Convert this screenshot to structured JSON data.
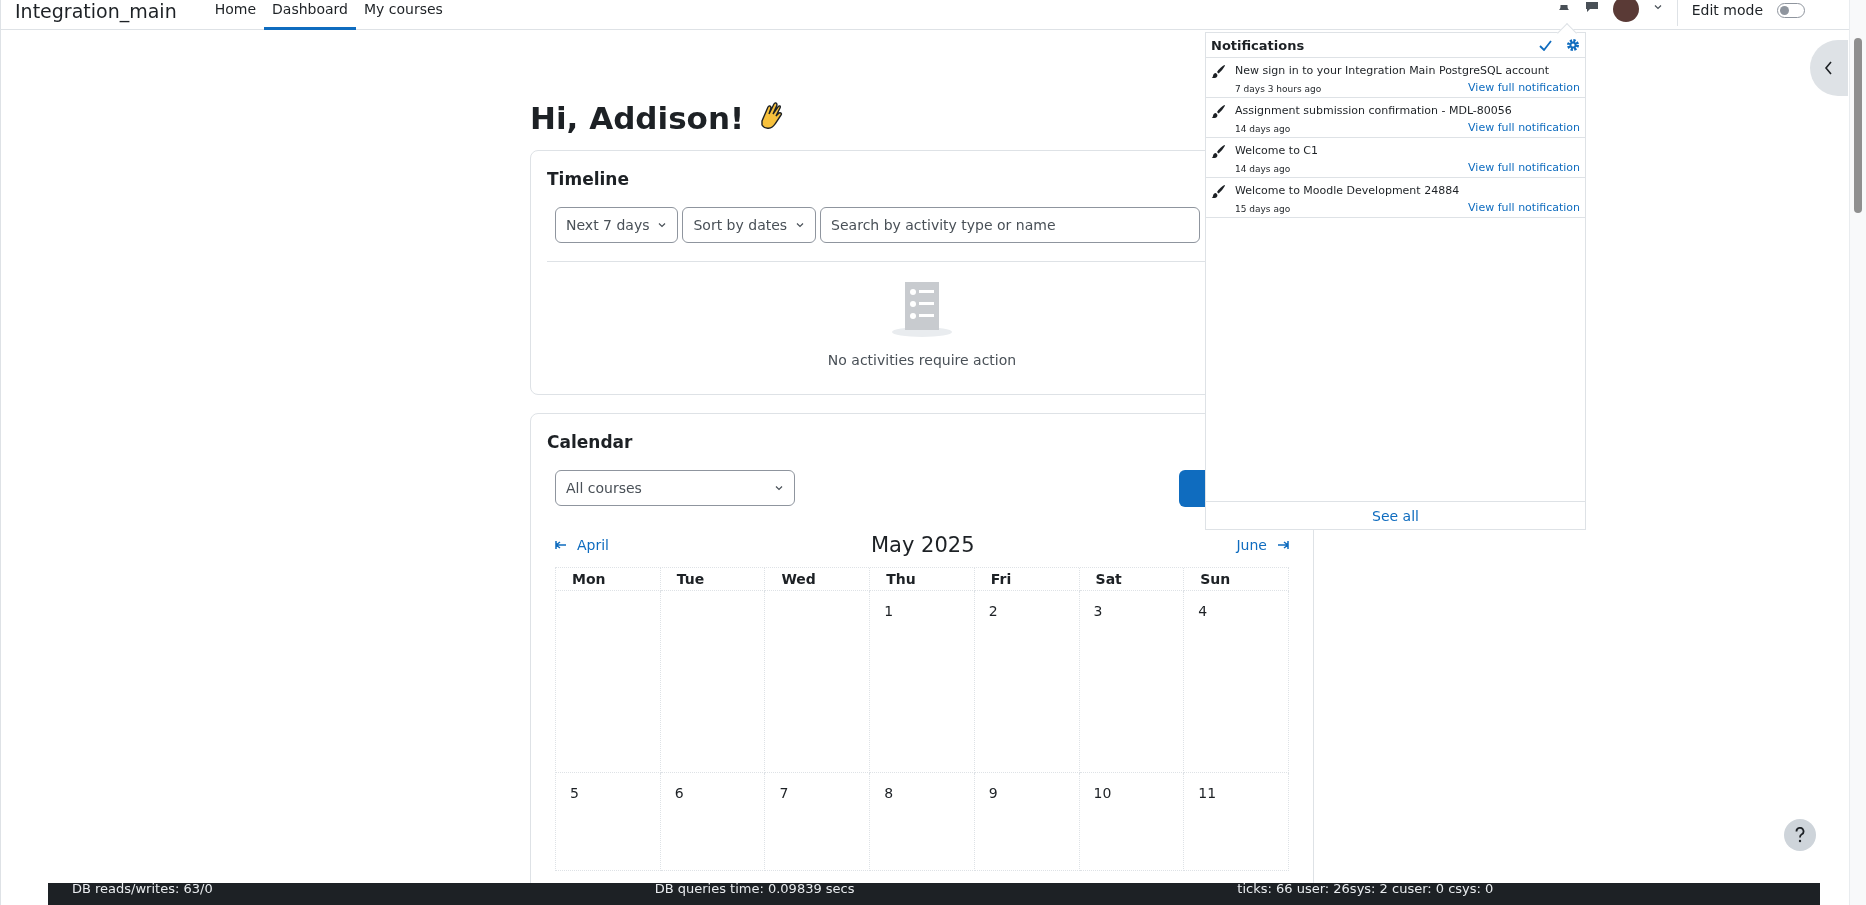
{
  "navbar": {
    "site_name": "Integration_main",
    "links": [
      {
        "label": "Home",
        "selected": false
      },
      {
        "label": "Dashboard",
        "selected": true
      },
      {
        "label": "My courses",
        "selected": false
      }
    ],
    "edit_mode": {
      "label": "Edit mode",
      "on": false
    }
  },
  "greeting": "Hi, Addison!",
  "timeline": {
    "title": "Timeline",
    "filter": "Next 7 days",
    "sort": "Sort by dates",
    "search": {
      "placeholder": "Search by activity type or name"
    },
    "empty_message": "No activities require action"
  },
  "calendar": {
    "title": "Calendar",
    "course_filter": "All courses",
    "prev_month": "April",
    "month": "May 2025",
    "next_month": "June",
    "weekdays": [
      "Mon",
      "Tue",
      "Wed",
      "Thu",
      "Fri",
      "Sat",
      "Sun"
    ],
    "weeks": [
      [
        {
          "day": "1"
        },
        {
          "day": "2"
        },
        {
          "day": "3"
        },
        {
          "day": "4"
        }
      ],
      [
        {
          "day": "5"
        },
        {
          "day": "6"
        },
        {
          "day": "7"
        },
        {
          "day": "8"
        },
        {
          "day": "9"
        },
        {
          "day": "10"
        },
        {
          "day": "11"
        }
      ]
    ]
  },
  "notifications": {
    "title": "Notifications",
    "items": [
      {
        "subject": "New sign in to your Integration Main PostgreSQL account",
        "time": "7 days 3 hours ago",
        "link": "View full notification"
      },
      {
        "subject": "Assignment submission confirmation - MDL-80056",
        "time": "14 days ago",
        "link": "View full notification"
      },
      {
        "subject": "Welcome to C1",
        "time": "14 days ago",
        "link": "View full notification"
      },
      {
        "subject": "Welcome to Moodle Development 24884",
        "time": "15 days ago",
        "link": "View full notification"
      }
    ],
    "see_all": "See all"
  },
  "footer": [
    "DB reads/writes: 63/0",
    "DB queries time: 0.09839 secs",
    "ticks: 66 user: 26sys: 2 cuser: 0 csys: 0"
  ]
}
